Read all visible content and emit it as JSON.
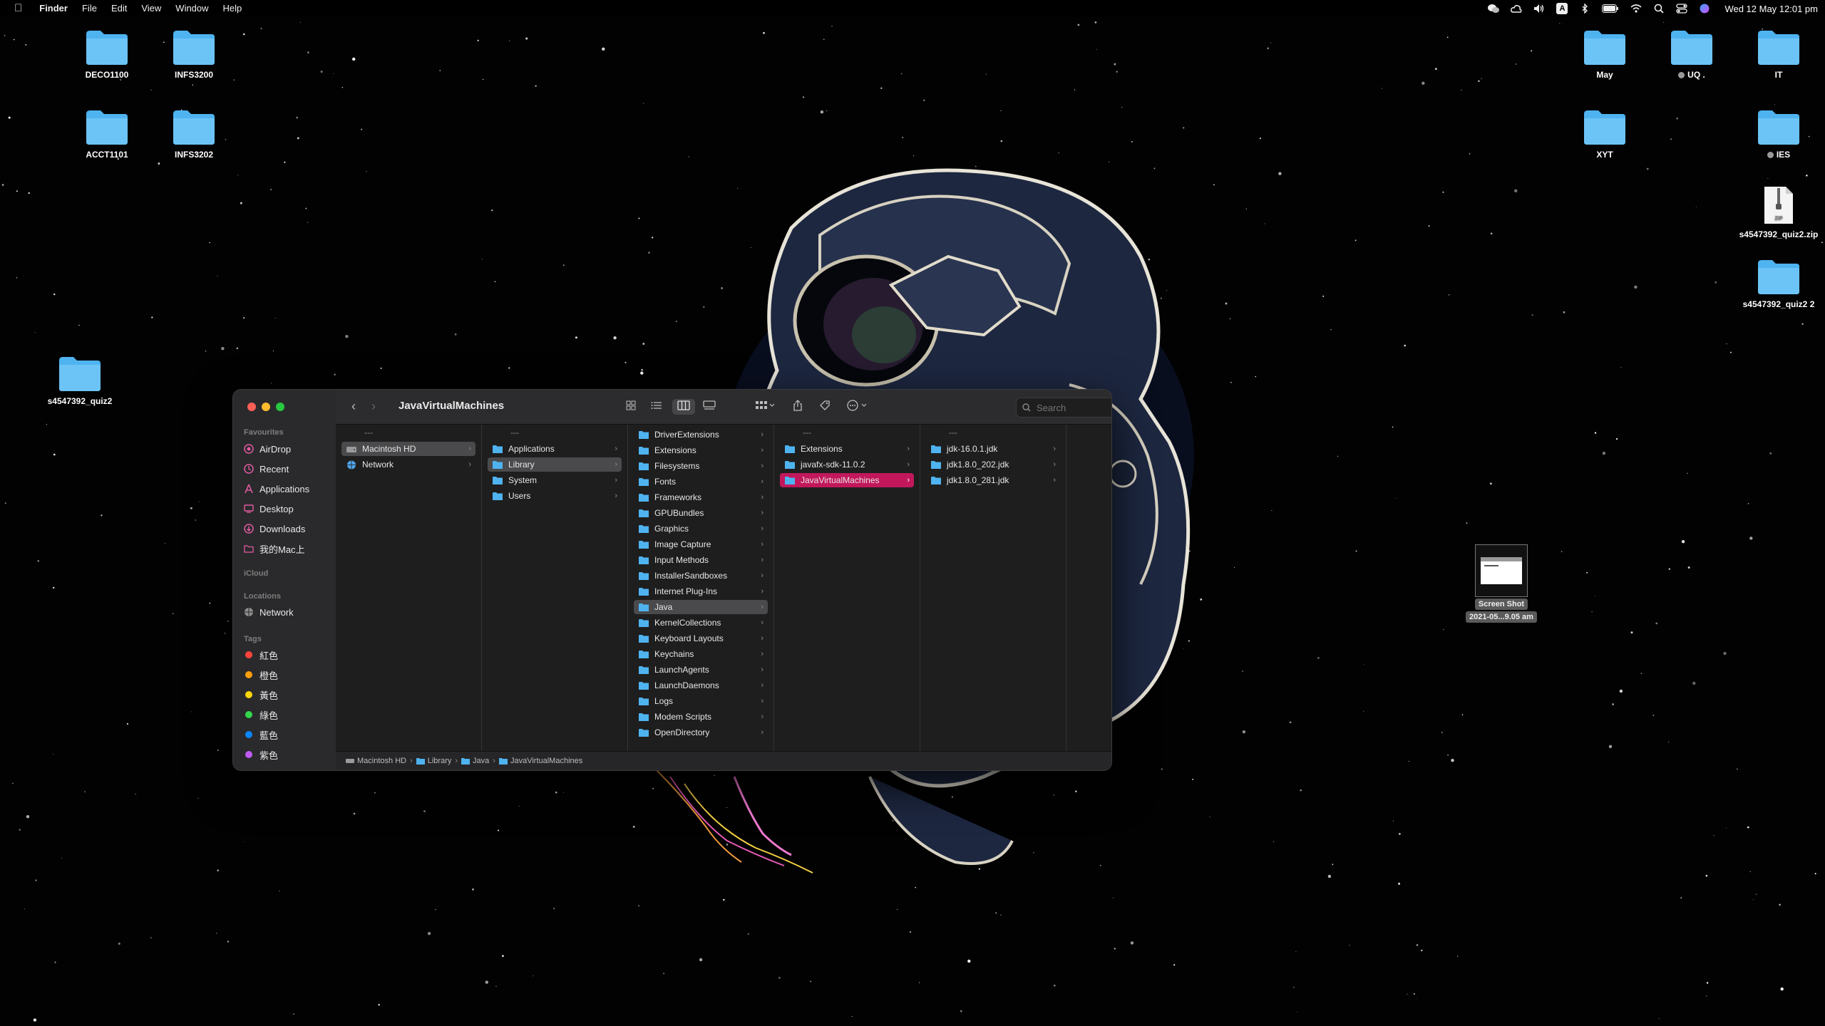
{
  "menubar": {
    "app": "Finder",
    "items": [
      "File",
      "Edit",
      "View",
      "Window",
      "Help"
    ],
    "clock": "Wed 12 May  12:01 pm",
    "input_badge": "A",
    "icons": [
      "wechat-icon",
      "cloud-icon",
      "volume-icon",
      "input-source-icon",
      "bluetooth-icon",
      "battery-icon",
      "wifi-icon",
      "spotlight-icon",
      "control-center-icon",
      "siri-icon"
    ]
  },
  "desktop": {
    "left_icons": [
      {
        "label": "DECO1100"
      },
      {
        "label": "INFS3200"
      },
      {
        "label": "ACCT1101"
      },
      {
        "label": "INFS3202"
      },
      {
        "label": "s4547392_quiz2"
      }
    ],
    "right_icons": [
      {
        "label": "May"
      },
      {
        "label": "UQ ."
      },
      {
        "label": "IT"
      },
      {
        "label": "XYT"
      },
      {
        "label": "IES"
      },
      {
        "label": "s4547392_quiz2.zip"
      },
      {
        "label": "s4547392_quiz2 2"
      }
    ],
    "screenshot": {
      "line1": "Screen Shot",
      "line2": "2021-05...9.05 am"
    }
  },
  "finder": {
    "title": "JavaVirtualMachines",
    "search_placeholder": "Search",
    "sidebar": {
      "favourites_label": "Favourites",
      "favourites": [
        "AirDrop",
        "Recent",
        "Applications",
        "Desktop",
        "Downloads",
        "我的Mac上"
      ],
      "icloud_label": "iCloud",
      "locations_label": "Locations",
      "locations": [
        "Network"
      ],
      "tags_label": "Tags",
      "tags": [
        {
          "name": "紅色",
          "color": "#ff453a"
        },
        {
          "name": "橙色",
          "color": "#ff9f0a"
        },
        {
          "name": "黃色",
          "color": "#ffd60a"
        },
        {
          "name": "綠色",
          "color": "#32d74b"
        },
        {
          "name": "藍色",
          "color": "#0a84ff"
        },
        {
          "name": "紫色",
          "color": "#bf5af2"
        }
      ]
    },
    "columns": [
      {
        "header": "---",
        "items": [
          "Macintosh HD",
          "Network"
        ]
      },
      {
        "header": "---",
        "items": [
          "Applications",
          "Library",
          "System",
          "Users"
        ]
      },
      {
        "header": "---",
        "items": [
          "DriverExtensions",
          "Extensions",
          "Filesystems",
          "Fonts",
          "Frameworks",
          "GPUBundles",
          "Graphics",
          "Image Capture",
          "Input Methods",
          "InstallerSandboxes",
          "Internet Plug-Ins",
          "Java",
          "KernelCollections",
          "Keyboard Layouts",
          "Keychains",
          "LaunchAgents",
          "LaunchDaemons",
          "Logs",
          "Modem Scripts",
          "OpenDirectory"
        ]
      },
      {
        "header": "---",
        "items": [
          "Extensions",
          "javafx-sdk-11.0.2",
          "JavaVirtualMachines"
        ]
      },
      {
        "header": "---",
        "items": [
          "jdk-16.0.1.jdk",
          "jdk1.8.0_202.jdk",
          "jdk1.8.0_281.jdk"
        ]
      }
    ],
    "path": [
      "Macintosh HD",
      "Library",
      "Java",
      "JavaVirtualMachines"
    ],
    "colors": {
      "folder": "#4fb3f0",
      "highlight": "#c2185b",
      "window_bg": "#1e1e1e"
    }
  }
}
